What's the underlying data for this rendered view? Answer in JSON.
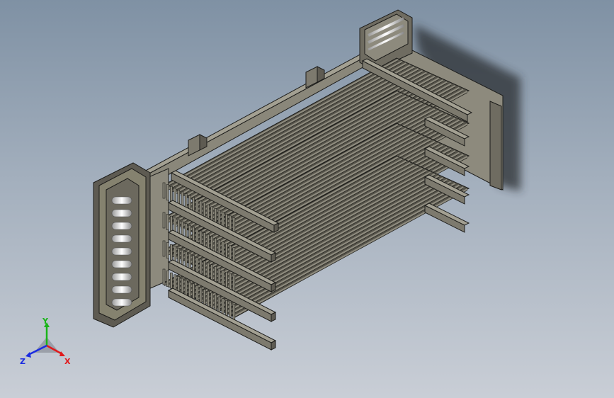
{
  "view": {
    "name": "isometric-view",
    "background_top": "#7f91a4",
    "background_bottom": "#c9ced6"
  },
  "model": {
    "name": "heat-exchanger-tube-bundle",
    "parts": [
      "left-header-frame",
      "right-header-frame",
      "left-end-plate",
      "right-end-plate",
      "tube-rows",
      "support-beams",
      "top-rail",
      "fin-rows",
      "mounting-brackets"
    ],
    "part_color": "#7d7a6e",
    "edge_color": "#1c1c1a"
  },
  "triad": {
    "x_label": "X",
    "y_label": "Y",
    "z_label": "Z",
    "x_color": "#e0191b",
    "y_color": "#19b419",
    "z_color": "#1b2ce0"
  }
}
